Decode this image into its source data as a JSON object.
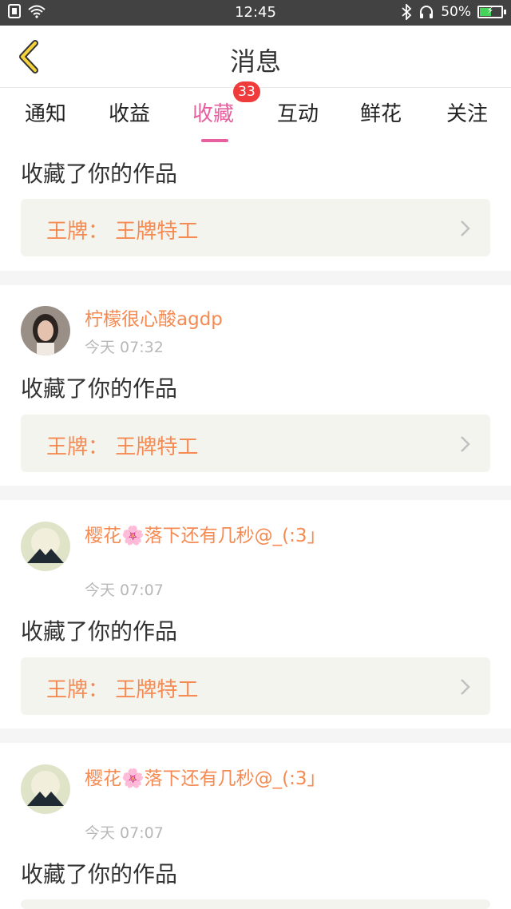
{
  "status_bar": {
    "time": "12:45",
    "battery": "50%"
  },
  "header": {
    "title": "消息"
  },
  "tabs": [
    {
      "label": "通知"
    },
    {
      "label": "收益"
    },
    {
      "label": "收藏",
      "badge": "33"
    },
    {
      "label": "互动"
    },
    {
      "label": "鲜花"
    },
    {
      "label": "关注"
    }
  ],
  "active_tab": "收藏",
  "feed": [
    {
      "action": "收藏了你的作品",
      "work_title": "王牌：  王牌特工"
    },
    {
      "user": "柠檬很心酸agdp",
      "time": "今天 07:32",
      "action": "收藏了你的作品",
      "work_title": "王牌：  王牌特工"
    },
    {
      "user": "樱花🌸落下还有几秒@_(:3」",
      "time": "今天 07:07",
      "action": "收藏了你的作品",
      "work_title": "王牌：  王牌特工"
    },
    {
      "user": "樱花🌸落下还有几秒@_(:3」",
      "time": "今天 07:07",
      "action": "收藏了你的作品"
    }
  ],
  "colors": {
    "accent": "#e75f9e",
    "username": "#f58a52",
    "badge": "#ef3b3b",
    "card_bg": "#f4f4ef"
  }
}
